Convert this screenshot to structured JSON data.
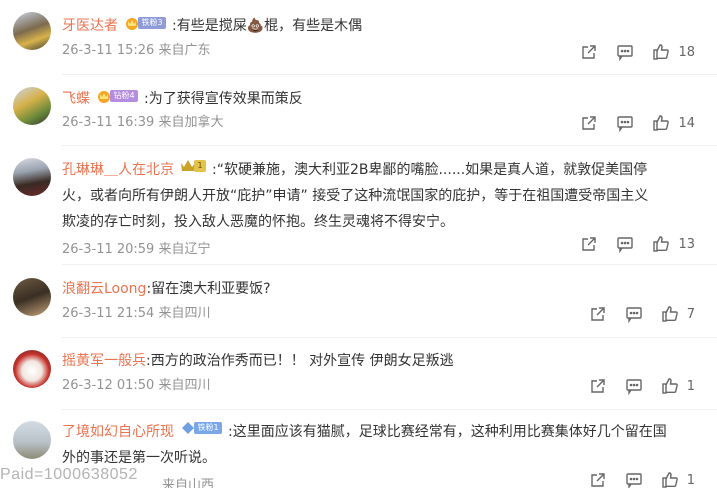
{
  "comments": [
    {
      "username": "牙医达者",
      "badge": "铁粉3",
      "text": ":有些是搅屎💩棍，有些是木偶",
      "meta": "26-3-11 15:26 来自广东",
      "likes": "18"
    },
    {
      "username": "飞蝶",
      "badge": "钻粉4",
      "text": ":为了获得宣传效果而策反",
      "meta": "26-3-11 16:39 来自加拿大",
      "likes": "14"
    },
    {
      "username": "孔琳琳＿人在北京",
      "badge": "1",
      "text_line1": ":“软硬兼施，澳大利亚2B卑鄙的嘴脸......如果是真人道，就敦促美国停",
      "text_line2": "火，或者向所有伊朗人开放“庇护”申请” 接受了这种流氓国家的庇护，等于在祖国遭受帝国主义",
      "text_line3": "欺凌的存亡时刻，投入敌人恶魔的怀抱。终生灵魂将不得安宁。",
      "meta": "26-3-11 20:59 来自辽宁",
      "likes": "13"
    },
    {
      "username": "浪翻云Loong",
      "text": ":留在澳大利亚要饭?",
      "meta": "26-3-11 21:54 来自四川",
      "likes": "7"
    },
    {
      "username": "摇黄军一般兵",
      "text": ":西方的政治作秀而已！！ 对外宣传 伊朗女足叛逃",
      "meta": "26-3-12 01:50 来自四川",
      "likes": "1"
    },
    {
      "username": "了境如幻自心所现",
      "badge": "铁粉1",
      "text_line1": ":这里面应该有猫腻，足球比赛经常有，这种利用比赛集体好几个留在国",
      "text_line2": "外的事还是第一次听说。",
      "meta": "来自山西",
      "likes": "1"
    }
  ],
  "watermark": "Paid=1000638052",
  "icons": [
    "share-icon",
    "comment-icon",
    "like-icon"
  ],
  "colors": {
    "username": "#eb7350",
    "meta": "#939393",
    "text": "#333333"
  }
}
